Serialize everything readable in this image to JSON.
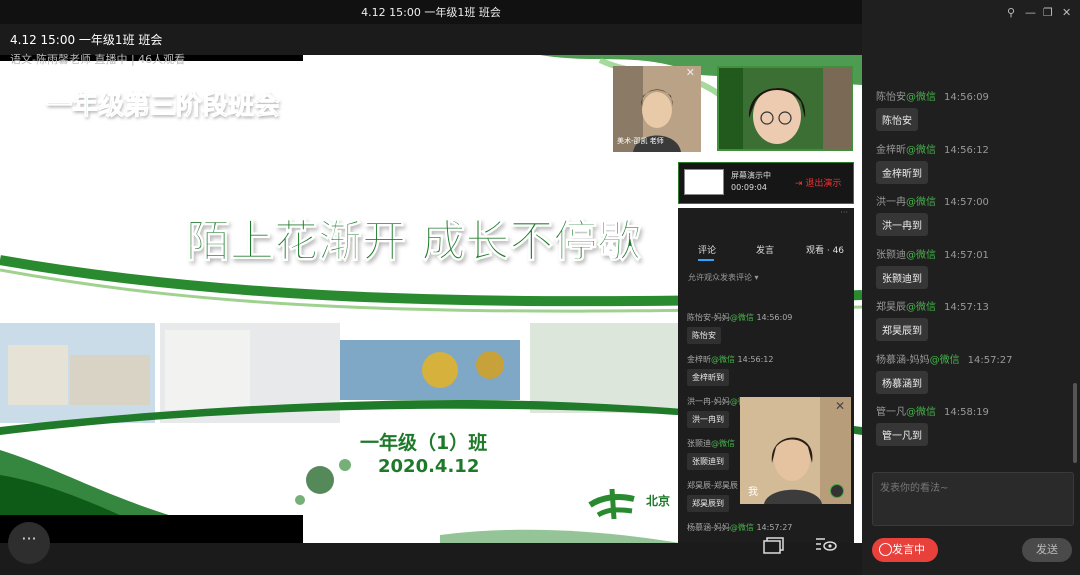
{
  "window": {
    "title": "4.12 15:00  一年级1班 班会"
  },
  "slide": {
    "title": "一年级第三阶段班会",
    "slogan": "陌上花渐开 成长不停歇",
    "class_name": "一年级（1）班",
    "date": "2020.4.12",
    "school_name": "北京"
  },
  "cameras": {
    "small_label": "美术-邵凯 老师",
    "self_label": "我"
  },
  "screen_share": {
    "status": "屏幕演示中",
    "timer": "00:09:04",
    "exit_label": "退出演示"
  },
  "comment_panel": {
    "tabs": [
      "评论",
      "发言",
      "观看 · 46"
    ],
    "allow_label": "允许观众发表评论",
    "items": [
      {
        "name": "陈怡安-妈妈",
        "source": "@微信",
        "time": "14:56:09",
        "text": "陈怡安"
      },
      {
        "name": "金梓昕",
        "source": "@微信",
        "time": "14:56:12",
        "text": "金梓昕到"
      },
      {
        "name": "洪一冉-妈妈",
        "source": "@微信",
        "time": "",
        "text": "洪一冉到"
      },
      {
        "name": "张颢迪",
        "source": "@微信",
        "time": "",
        "text": "张颢迪到"
      },
      {
        "name": "郑昊辰-郑昊辰",
        "source": "",
        "time": "",
        "text": "郑昊辰到"
      },
      {
        "name": "杨慕涵-妈妈",
        "source": "@微信",
        "time": "14:57:27",
        "text": ""
      }
    ]
  },
  "right_panel": {
    "title": "4.12 15:00  一年级1班 班会",
    "subtitle": "语文-陈雨馨老师 直播中 | 46人观看",
    "messages": [
      {
        "name": "陈怡安",
        "source": "@微信",
        "time": "14:56:09",
        "text": "陈怡安"
      },
      {
        "name": "金梓昕",
        "source": "@微信",
        "time": "14:56:12",
        "text": "金梓昕到"
      },
      {
        "name": "洪一冉",
        "source": "@微信",
        "time": "14:57:00",
        "text": "洪一冉到"
      },
      {
        "name": "张颢迪",
        "source": "@微信",
        "time": "14:57:01",
        "text": "张颢迪到"
      },
      {
        "name": "郑昊辰",
        "source": "@微信",
        "time": "14:57:13",
        "text": "郑昊辰到"
      },
      {
        "name": "杨慕涵-妈妈",
        "source": "@微信",
        "time": "14:57:27",
        "text": "杨慕涵到"
      },
      {
        "name": "管一凡",
        "source": "@微信",
        "time": "14:58:19",
        "text": "管一凡到"
      }
    ],
    "input_placeholder": "发表你的看法~",
    "speak_label": "发言中",
    "send_label": "发送"
  },
  "colors": {
    "accent_green": "#1e7a2a",
    "wechat_green": "#46b34a",
    "speak_red": "#e8413c"
  }
}
